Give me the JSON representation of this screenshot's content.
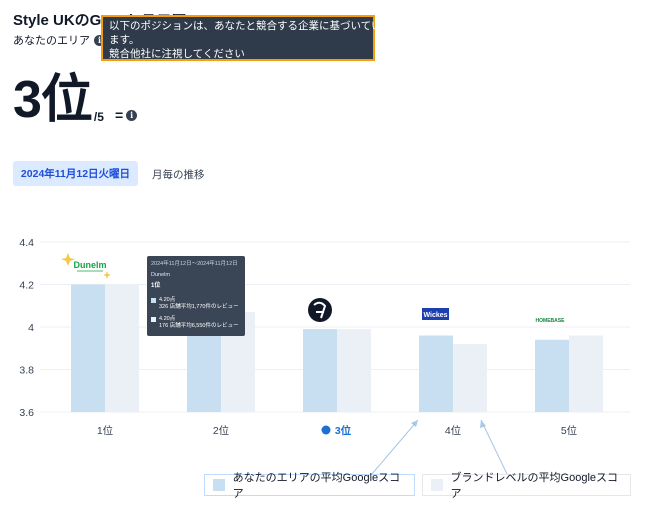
{
  "page": {
    "title": "Style UKのGoogleスコア",
    "area_label": "あなたのエリア",
    "tooltip_lines": [
      "以下のポジションは、あなたと競合する企業に基づいてい",
      "ます。",
      "競合他社に注視してください"
    ],
    "rank_value": "3位",
    "rank_denominator": "/5",
    "rank_change": "=",
    "info_glyph": "i"
  },
  "tabs": {
    "date": "2024年11月12日火曜日",
    "monthly": "月毎の推移"
  },
  "popup": {
    "date_range": "2024年11月12日〜2024年11月12日",
    "brand": "Dunelm",
    "rank": "1位",
    "rows": [
      {
        "score": "4.20点",
        "detail": "326 店舗平均1,770件のレビュー",
        "color": "#c8dff2"
      },
      {
        "score": "4.20点",
        "detail": "176 店舗平均6,550件のレビュー",
        "color": "#eaf0f5"
      }
    ]
  },
  "brands": {
    "dunelm": "Dunelm",
    "wickes": "Wickes",
    "homebase": "HOMEBASE"
  },
  "chart_data": {
    "type": "bar",
    "categories": [
      "1位",
      "2位",
      "3位",
      "4位",
      "5位"
    ],
    "highlight_index": 2,
    "series": [
      {
        "name": "あなたのエリアの平均Googleスコア",
        "values": [
          4.2,
          4.06,
          3.99,
          3.96,
          3.94
        ],
        "color": "#c8dff2"
      },
      {
        "name": "ブランドレベルの平均Googleスコア",
        "values": [
          4.2,
          4.07,
          3.99,
          3.92,
          3.96
        ],
        "color": "#eaf0f5"
      }
    ],
    "yticks": [
      "4.4",
      "4.2",
      "4",
      "3.8",
      "3.6"
    ],
    "ylim": [
      3.6,
      4.4
    ],
    "grid": true,
    "legend_position": "bottom"
  },
  "colors": {
    "accent": "#1d6fd1",
    "tooltip_border": "#f59e0b"
  }
}
